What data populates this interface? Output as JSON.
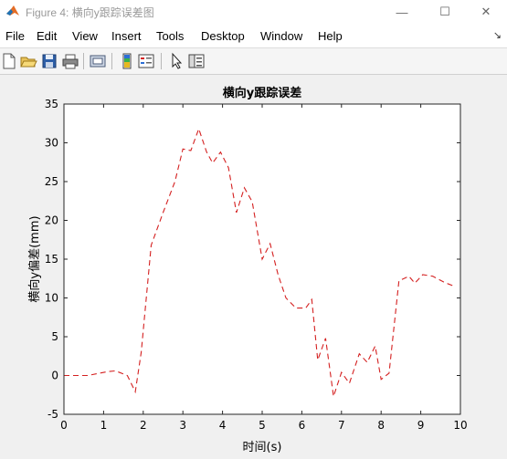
{
  "window": {
    "title": "Figure 4: 横向y跟踪误差图",
    "minimize_glyph": "—",
    "maximize_glyph": "☐",
    "close_glyph": "✕"
  },
  "menubar": {
    "items": [
      "File",
      "Edit",
      "View",
      "Insert",
      "Tools",
      "Desktop",
      "Window",
      "Help"
    ],
    "dock_arrow_glyph": "↘"
  },
  "toolbar": {
    "icons": [
      "new-figure-icon",
      "open-file-icon",
      "save-icon",
      "print-icon",
      "link-plot-icon",
      "insert-colorbar-icon",
      "insert-legend-icon",
      "edit-plot-arrow-icon",
      "property-inspector-icon"
    ]
  },
  "chart_data": {
    "type": "line",
    "title": "横向y跟踪误差",
    "xlabel": "时间(s)",
    "ylabel": "横向y偏差(mm)",
    "xlim": [
      0,
      10
    ],
    "ylim": [
      -5,
      35
    ],
    "xticks": [
      "0",
      "1",
      "2",
      "3",
      "4",
      "5",
      "6",
      "7",
      "8",
      "9",
      "10"
    ],
    "yticks": [
      "-5",
      "0",
      "5",
      "10",
      "15",
      "20",
      "25",
      "30",
      "35"
    ],
    "grid": false,
    "series": [
      {
        "color": "#d42020",
        "line_style": "dashed",
        "x": [
          0,
          0.6,
          1.1,
          1.3,
          1.6,
          1.8,
          1.95,
          2.2,
          2.5,
          2.8,
          3.0,
          3.2,
          3.4,
          3.6,
          3.75,
          3.95,
          4.15,
          4.35,
          4.55,
          4.75,
          5.0,
          5.2,
          5.4,
          5.6,
          5.85,
          6.1,
          6.25,
          6.4,
          6.6,
          6.8,
          7.0,
          7.2,
          7.45,
          7.65,
          7.85,
          8.0,
          8.2,
          8.45,
          8.7,
          8.85,
          9.05,
          9.3,
          9.6,
          9.85
        ],
        "y": [
          0,
          0,
          0.5,
          0.6,
          0,
          -2.1,
          3.0,
          16.8,
          21.0,
          25.0,
          29.2,
          29.0,
          31.8,
          28.8,
          27.4,
          28.8,
          26.8,
          21.0,
          24.2,
          22.4,
          15.0,
          17.0,
          13.0,
          10.0,
          8.7,
          8.7,
          9.8,
          2.0,
          4.8,
          -2.7,
          0.4,
          -1.0,
          2.8,
          1.7,
          3.8,
          -0.5,
          0.3,
          12.2,
          12.8,
          11.9,
          13.0,
          12.8,
          12.0,
          11.5
        ]
      }
    ]
  }
}
